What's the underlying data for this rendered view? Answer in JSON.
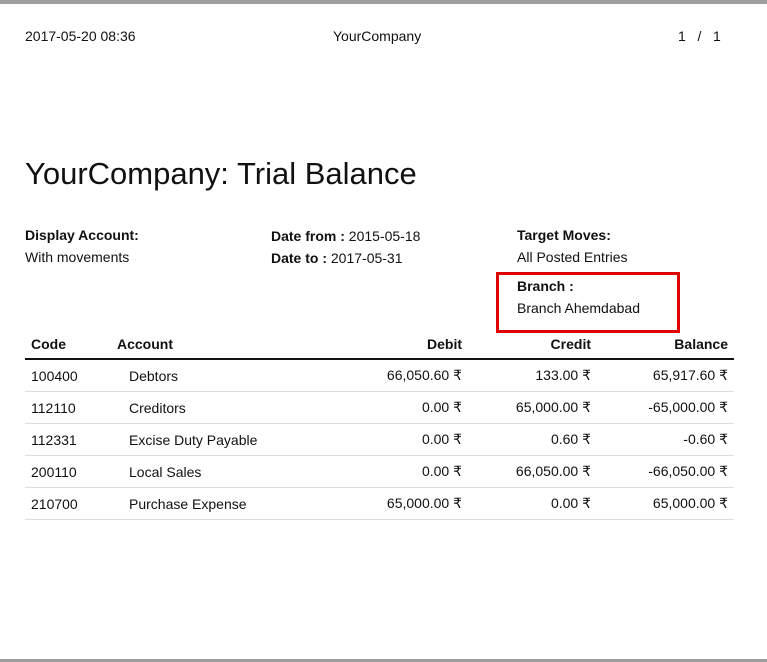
{
  "header": {
    "datetime": "2017-05-20 08:36",
    "company": "YourCompany",
    "page_current": "1",
    "page_sep": "/",
    "page_total": "1"
  },
  "report": {
    "title": "YourCompany: Trial Balance",
    "display_account_label": "Display Account:",
    "display_account_value": "With movements",
    "date_from_label": "Date from :",
    "date_from_value": "2015-05-18",
    "date_to_label": "Date to :",
    "date_to_value": "2017-05-31",
    "target_moves_label": "Target Moves:",
    "target_moves_value": "All Posted Entries",
    "branch_label": "Branch :",
    "branch_value": "Branch Ahemdabad"
  },
  "table": {
    "columns": [
      "Code",
      "Account",
      "Debit",
      "Credit",
      "Balance"
    ],
    "rows": [
      {
        "code": "100400",
        "account": "Debtors",
        "debit": "66,050.60 ₹",
        "credit": "133.00 ₹",
        "balance": "65,917.60 ₹"
      },
      {
        "code": "112110",
        "account": "Creditors",
        "debit": "0.00 ₹",
        "credit": "65,000.00 ₹",
        "balance": "-65,000.00 ₹"
      },
      {
        "code": "112331",
        "account": "Excise Duty Payable",
        "debit": "0.00 ₹",
        "credit": "0.60 ₹",
        "balance": "-0.60 ₹"
      },
      {
        "code": "200110",
        "account": "Local Sales",
        "debit": "0.00 ₹",
        "credit": "66,050.00 ₹",
        "balance": "-66,050.00 ₹"
      },
      {
        "code": "210700",
        "account": "Purchase Expense",
        "debit": "65,000.00 ₹",
        "credit": "0.00 ₹",
        "balance": "65,000.00 ₹"
      }
    ]
  },
  "colors": {
    "highlight_border": "#e00000",
    "page_rule": "#9e9e9e"
  }
}
